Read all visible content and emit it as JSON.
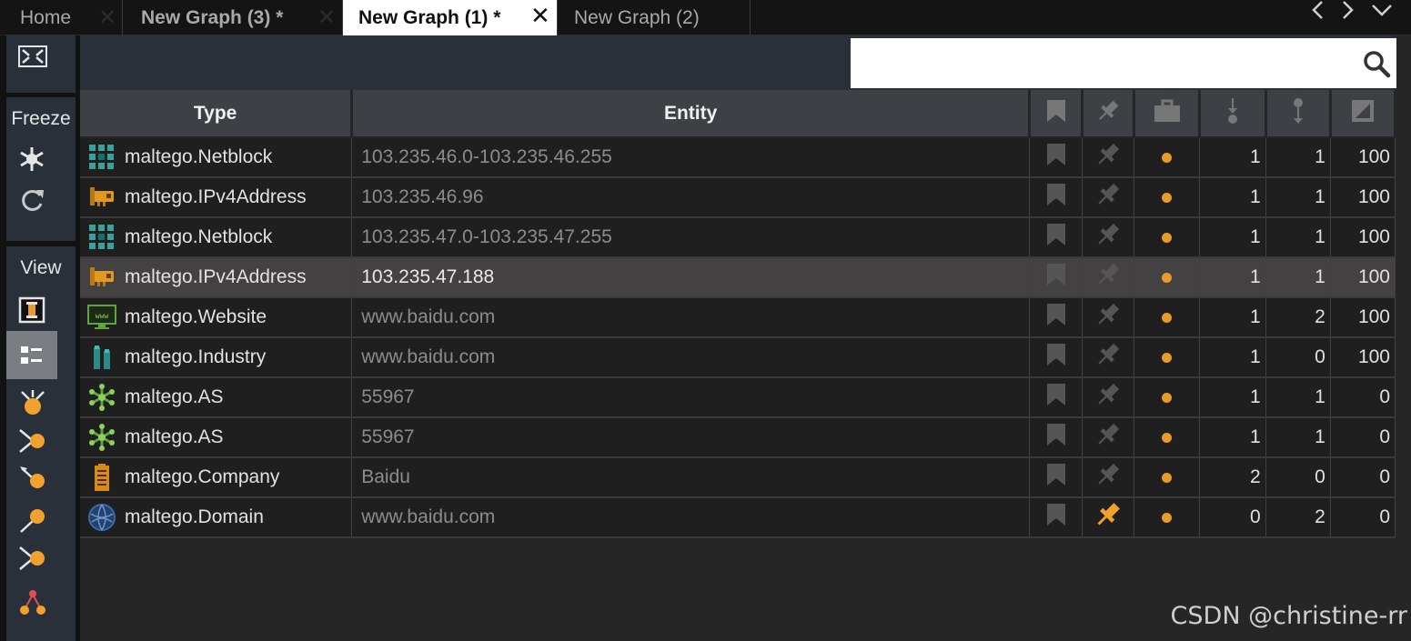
{
  "tabs": [
    {
      "label": "Home",
      "close": "✕"
    },
    {
      "label": "New Graph (3) *",
      "close": "✕"
    },
    {
      "label": "New Graph (1) *",
      "close": "✕",
      "active": true
    },
    {
      "label": "New Graph (2)",
      "close": ""
    }
  ],
  "tab_nav": {
    "prev": "‹",
    "next": "›",
    "menu": "⌄"
  },
  "left_toolbar": {
    "freeze_label": "Freeze",
    "view_label": "View",
    "icons": [
      "fit-view-icon",
      "freeze-snowflake-icon",
      "refresh-icon",
      "entity-view-icon",
      "list-view-icon",
      "bubble-view-icon",
      "incoming-links-icon",
      "outgoing-links-icon",
      "link-end-icon",
      "link-both-icon",
      "hierarchy-icon"
    ]
  },
  "search": {
    "value": "",
    "placeholder": ""
  },
  "table": {
    "headers": {
      "type": "Type",
      "entity": "Entity"
    },
    "icon_columns": [
      "bookmark-icon",
      "pin-icon",
      "briefcase-icon",
      "incoming-icon",
      "outgoing-icon",
      "weight-icon"
    ],
    "rows": [
      {
        "type": "maltego.Netblock",
        "icon": "netblock-icon",
        "entity": "103.235.46.0-103.235.46.255",
        "pinned": false,
        "in": "1",
        "out": "1",
        "weight": "100"
      },
      {
        "type": "maltego.IPv4Address",
        "icon": "ipv4-icon",
        "entity": "103.235.46.96",
        "pinned": false,
        "in": "1",
        "out": "1",
        "weight": "100"
      },
      {
        "type": "maltego.Netblock",
        "icon": "netblock-icon",
        "entity": "103.235.47.0-103.235.47.255",
        "pinned": false,
        "in": "1",
        "out": "1",
        "weight": "100"
      },
      {
        "type": "maltego.IPv4Address",
        "icon": "ipv4-icon",
        "entity": "103.235.47.188",
        "pinned": false,
        "in": "1",
        "out": "1",
        "weight": "100",
        "selected": true
      },
      {
        "type": "maltego.Website",
        "icon": "website-icon",
        "entity": "www.baidu.com",
        "pinned": false,
        "in": "1",
        "out": "2",
        "weight": "100"
      },
      {
        "type": "maltego.Industry",
        "icon": "industry-icon",
        "entity": "www.baidu.com",
        "pinned": false,
        "in": "1",
        "out": "0",
        "weight": "100"
      },
      {
        "type": "maltego.AS",
        "icon": "as-icon",
        "entity": "55967",
        "pinned": false,
        "in": "1",
        "out": "1",
        "weight": "0"
      },
      {
        "type": "maltego.AS",
        "icon": "as-icon",
        "entity": "55967",
        "pinned": false,
        "in": "1",
        "out": "1",
        "weight": "0"
      },
      {
        "type": "maltego.Company",
        "icon": "company-icon",
        "entity": "Baidu",
        "pinned": false,
        "in": "2",
        "out": "0",
        "weight": "0"
      },
      {
        "type": "maltego.Domain",
        "icon": "domain-icon",
        "entity": "www.baidu.com",
        "pinned": true,
        "in": "0",
        "out": "2",
        "weight": "0"
      }
    ]
  },
  "colors": {
    "accent": "#e89b2b",
    "panel": "#29303a",
    "header": "#3d4045",
    "selected_row": "#434141"
  },
  "watermark": "CSDN @christine-rr"
}
